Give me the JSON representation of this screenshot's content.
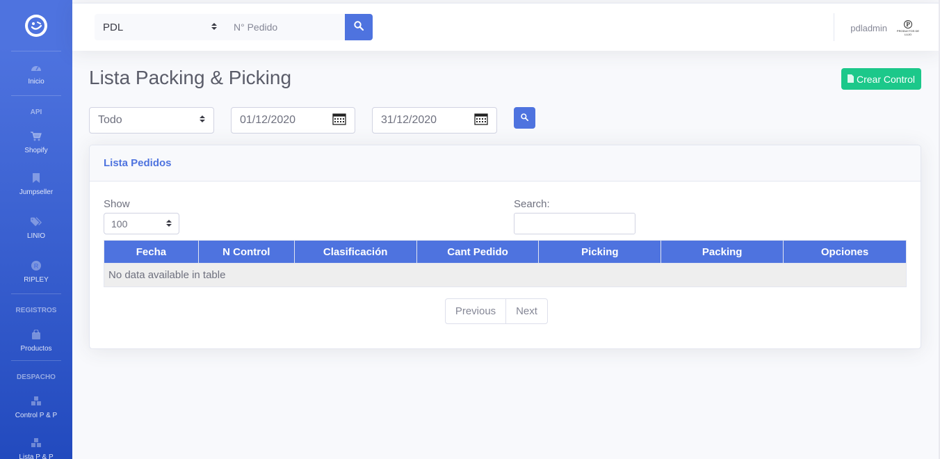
{
  "sidebar": {
    "items": [
      {
        "label": "Inicio",
        "icon": "dashboard-icon"
      },
      {
        "heading": "API"
      },
      {
        "label": "Shopify",
        "icon": "cart-icon"
      },
      {
        "label": "Jumpseller",
        "icon": "bookmark-icon"
      },
      {
        "label": "LINIO",
        "icon": "tags-icon"
      },
      {
        "label": "RIPLEY",
        "icon": "r-circle-icon"
      },
      {
        "heading": "REGISTROS"
      },
      {
        "label": "Productos",
        "icon": "shopping-bag-icon"
      },
      {
        "heading": "DESPACHO"
      },
      {
        "label": "Control P & P",
        "icon": "cubes-icon"
      },
      {
        "label": "Lista P & P",
        "icon": "cubes-icon"
      }
    ],
    "headings": {
      "api": "API",
      "registros": "REGISTROS",
      "despacho": "DESPACHO"
    },
    "labels": {
      "inicio": "Inicio",
      "shopify": "Shopify",
      "jumpseller": "Jumpseller",
      "linio": "LINIO",
      "ripley": "RIPLEY",
      "productos": "Productos",
      "control": "Control P & P",
      "lista": "Lista P & P"
    }
  },
  "topbar": {
    "store_select": "PDL",
    "order_placeholder": "N° Pedido",
    "user_name": "pdladmin",
    "logo_text": "PRODUCTOS DE LUJO",
    "logo_letter": "P"
  },
  "page": {
    "title": "Lista Packing & Picking",
    "create_button": "Crear Control"
  },
  "filters": {
    "status": "Todo",
    "date_from": "01/12/2020",
    "date_to": "31/12/2020"
  },
  "card": {
    "title": "Lista Pedidos",
    "show_label": "Show",
    "show_value": "100",
    "search_label": "Search:"
  },
  "table": {
    "headers": [
      "Fecha",
      "N Control",
      "Clasificación",
      "Cant Pedido",
      "Picking",
      "Packing",
      "Opciones"
    ],
    "empty_message": "No data available in table"
  },
  "pagination": {
    "previous": "Previous",
    "next": "Next"
  },
  "colors": {
    "primary": "#4e73df",
    "success": "#1cc88a",
    "background": "#f8f9fc"
  }
}
